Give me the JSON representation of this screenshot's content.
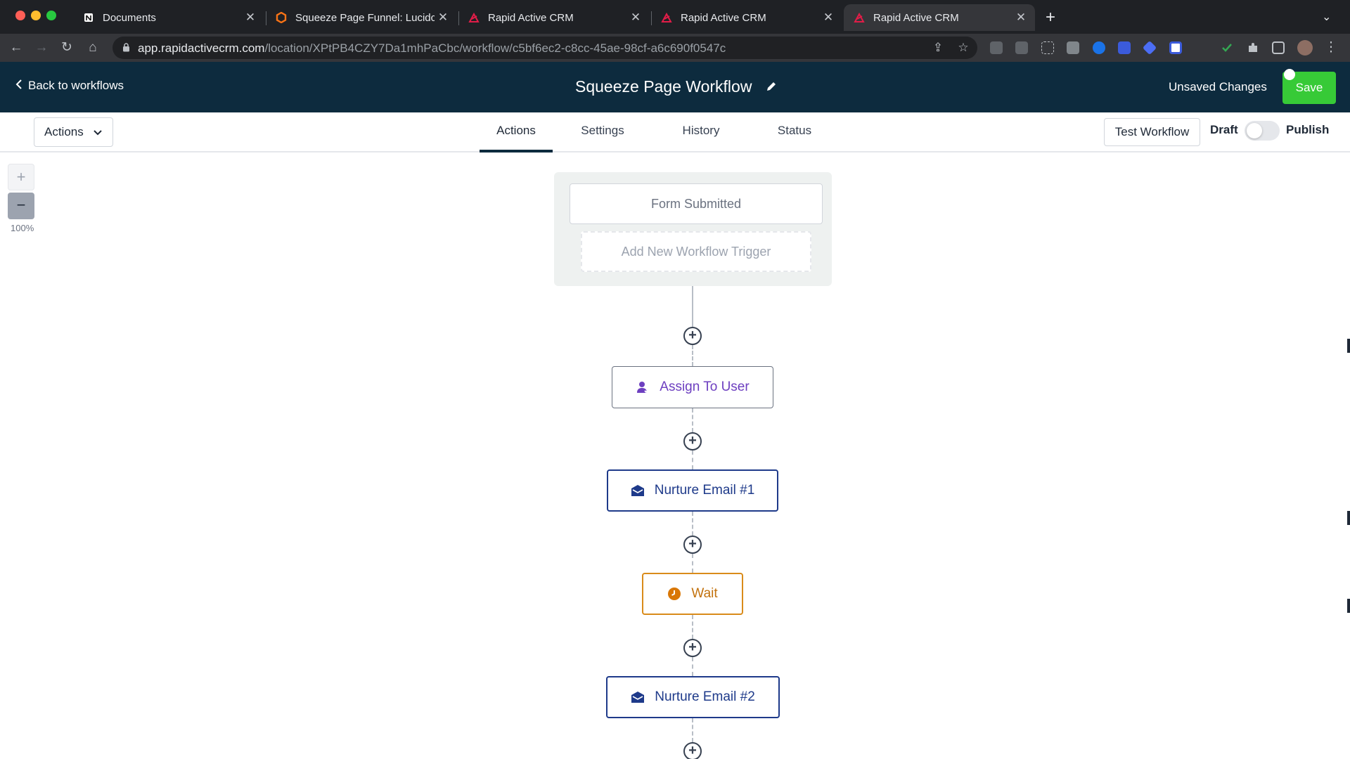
{
  "browser": {
    "tabs": [
      {
        "title": "Documents",
        "icon": "notion-icon",
        "active": false
      },
      {
        "title": "Squeeze Page Funnel: Lucidch",
        "icon": "lucidchart-icon",
        "active": false
      },
      {
        "title": "Rapid Active CRM",
        "icon": "crm-icon",
        "active": false
      },
      {
        "title": "Rapid Active CRM",
        "icon": "crm-icon",
        "active": false
      },
      {
        "title": "Rapid Active CRM",
        "icon": "crm-icon",
        "active": true
      }
    ],
    "new_tab": "+",
    "url_host": "app.rapidactivecrm.com",
    "url_path": "/location/XPtPB4CZY7Da1mhPaCbc/workflow/c5bf6ec2-c8cc-45ae-98cf-a6c690f0547c"
  },
  "header": {
    "back_label": "Back to workflows",
    "title": "Squeeze Page Workflow",
    "unsaved": "Unsaved Changes",
    "save_label": "Save"
  },
  "subnav": {
    "actions_label": "Actions",
    "tabs": [
      {
        "label": "Actions",
        "active": true
      },
      {
        "label": "Settings",
        "active": false
      },
      {
        "label": "History",
        "active": false
      },
      {
        "label": "Status",
        "active": false
      }
    ],
    "test_workflow": "Test Workflow",
    "draft": "Draft",
    "publish": "Publish",
    "published": false
  },
  "canvas": {
    "zoom_in": "+",
    "zoom_out": "−",
    "zoom_level": "100%",
    "trigger": "Form Submitted",
    "add_trigger": "Add New Workflow Trigger",
    "add_step": "+",
    "steps": [
      {
        "label": "Assign To User",
        "icon": "assign-user-icon",
        "color": "#6d3fc0"
      },
      {
        "label": "Nurture Email #1",
        "icon": "email-icon",
        "color": "#1e3a8a"
      },
      {
        "label": "Wait",
        "icon": "clock-icon",
        "color": "#c2710c"
      },
      {
        "label": "Nurture Email #2",
        "icon": "email-icon",
        "color": "#1e3a8a"
      }
    ]
  },
  "colors": {
    "header_bg": "#0d2b3e",
    "save_green": "#37ca37",
    "trigger_panel": "#eef1f0"
  }
}
